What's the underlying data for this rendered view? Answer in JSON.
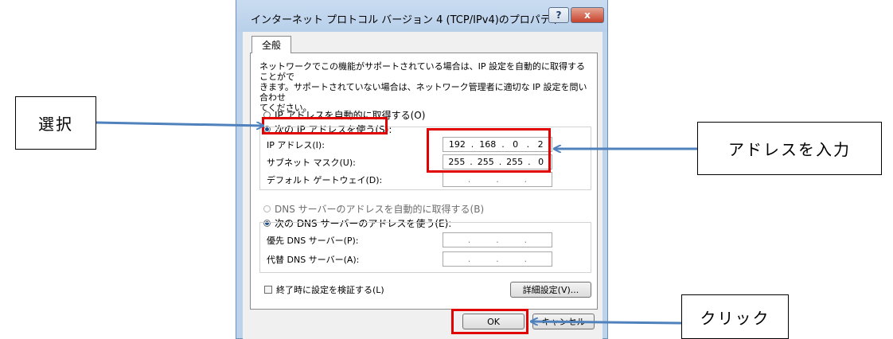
{
  "dialog": {
    "title": "インターネット プロトコル バージョン 4 (TCP/IPv4)のプロパティ",
    "help_button": "?",
    "close_button": "x",
    "tab_general": "全般",
    "description_line1": "ネットワークでこの機能がサポートされている場合は、IP 設定を自動的に取得することがで",
    "description_line2": "きます。サポートされていない場合は、ネットワーク管理者に適切な IP 設定を問い合わせ",
    "description_line3": "てください。",
    "radio_auto_ip": "IP アドレスを自動的に取得する(O)",
    "radio_use_ip": "次の IP アドレスを使う(S):",
    "ip_address_label": "IP アドレス(I):",
    "ip_address": [
      "192",
      "168",
      "0",
      "2"
    ],
    "subnet_label": "サブネット マスク(U):",
    "subnet_mask": [
      "255",
      "255",
      "255",
      "0"
    ],
    "gateway_label": "デフォルト ゲートウェイ(D):",
    "radio_auto_dns": "DNS サーバーのアドレスを自動的に取得する(B)",
    "radio_use_dns": "次の DNS サーバーのアドレスを使う(E):",
    "preferred_dns_label": "優先 DNS サーバー(P):",
    "alternate_dns_label": "代替 DNS サーバー(A):",
    "validate_checkbox": "終了時に設定を検証する(L)",
    "advanced_button": "詳細設定(V)...",
    "ok_button": "OK",
    "cancel_button": "キャンセル",
    "empty_ip_dots": ".",
    "selected_radio_ip": "use_ip",
    "selected_radio_dns": "use_dns"
  },
  "annotations": {
    "select_label": "選択",
    "address_label": "アドレスを入力",
    "click_label": "クリック",
    "arrow_color": "#4f81bd",
    "highlight_color": "#e00000"
  }
}
